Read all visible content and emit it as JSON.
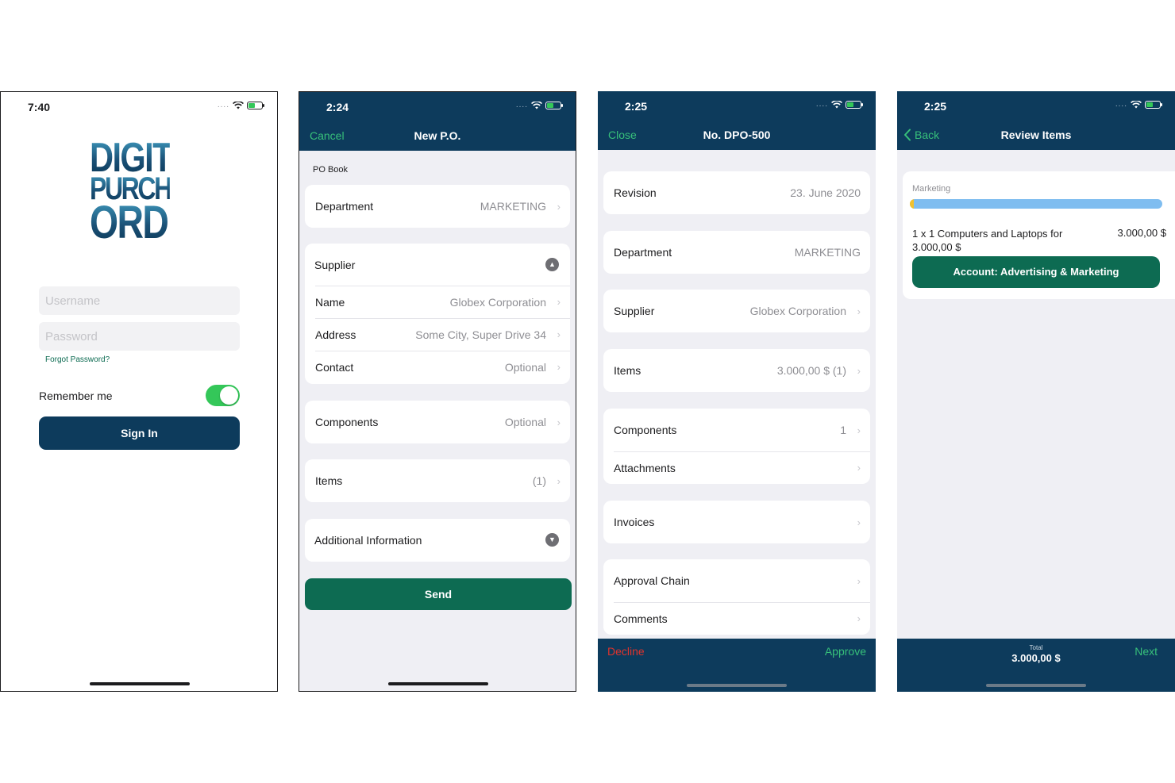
{
  "login": {
    "time": "7:40",
    "logo_lines": [
      "DIGITAL",
      "PURCHASE",
      "ORDER"
    ],
    "username_placeholder": "Username",
    "password_placeholder": "Password",
    "forgot_password": "Forgot Password?",
    "remember_me": "Remember me",
    "remember_me_on": true,
    "sign_in": "Sign In"
  },
  "new_po": {
    "time": "2:24",
    "cancel": "Cancel",
    "title": "New P.O.",
    "section_header": "PO Book",
    "department": {
      "label": "Department",
      "value": "MARKETING"
    },
    "supplier": {
      "header": "Supplier",
      "rows": [
        {
          "label": "Name",
          "value": "Globex Corporation"
        },
        {
          "label": "Address",
          "value": "Some City, Super Drive 34"
        },
        {
          "label": "Contact",
          "value": "Optional"
        }
      ]
    },
    "components": {
      "label": "Components",
      "value": "Optional"
    },
    "items": {
      "label": "Items",
      "value": "(1)"
    },
    "additional_info": "Additional Information",
    "send": "Send"
  },
  "dpo": {
    "time": "2:25",
    "close": "Close",
    "title": "No. DPO-500",
    "revision": {
      "label": "Revision",
      "value": "23. June 2020"
    },
    "department": {
      "label": "Department",
      "value": "MARKETING"
    },
    "supplier": {
      "label": "Supplier",
      "value": "Globex Corporation"
    },
    "items": {
      "label": "Items",
      "value": "3.000,00 $ (1)"
    },
    "components": {
      "label": "Components",
      "value": "1"
    },
    "attachments": {
      "label": "Attachments",
      "value": ""
    },
    "invoices": {
      "label": "Invoices",
      "value": ""
    },
    "approval_chain": {
      "label": "Approval Chain",
      "value": ""
    },
    "comments": {
      "label": "Comments",
      "value": ""
    },
    "decline": "Decline",
    "approve": "Approve"
  },
  "review": {
    "time": "2:25",
    "back": "Back",
    "title": "Review Items",
    "department": "Marketing",
    "item_text": "1 x 1 Computers and Laptops for 3.000,00 $",
    "item_price": "3.000,00 $",
    "account": "Account: Advertising & Marketing",
    "total_label": "Total",
    "total_value": "3.000,00 $",
    "next": "Next"
  },
  "icons": {
    "wifi": "wifi-icon",
    "battery": "battery-charging-icon",
    "chevron": "chevron-right-icon",
    "collapse": "chevron-up-circle-icon",
    "expand": "chevron-down-circle-icon",
    "back": "chevron-left-icon"
  },
  "colors": {
    "navy": "#0d3b5c",
    "green": "#0d6b52",
    "accent_green": "#37c07a",
    "decline_red": "#e0332c",
    "toggle_on": "#34c759"
  }
}
